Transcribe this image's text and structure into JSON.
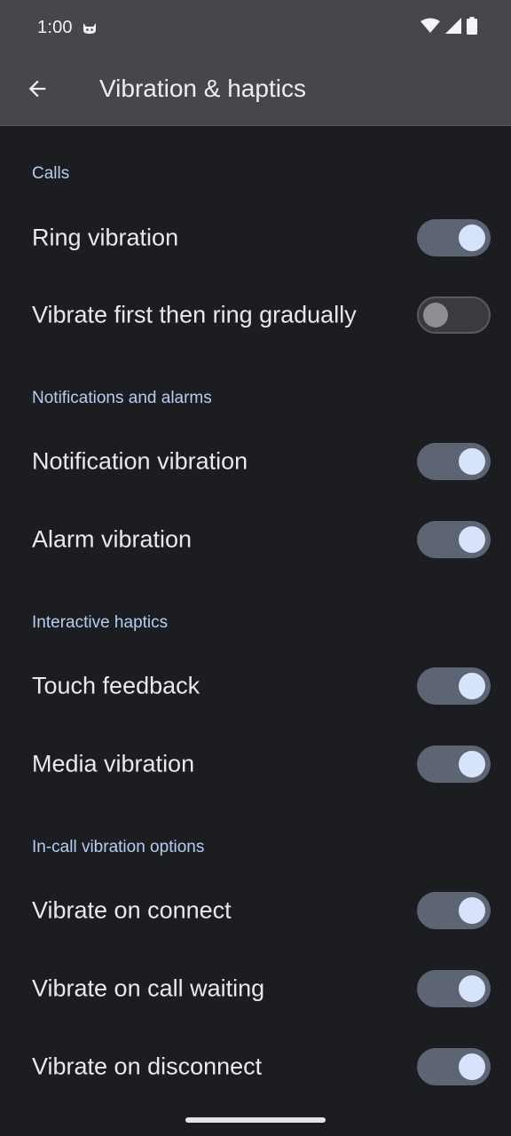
{
  "status_bar": {
    "time": "1:00",
    "icons": [
      "cat-app-icon",
      "wifi-icon",
      "cell-signal-icon",
      "battery-icon"
    ]
  },
  "app_bar": {
    "back_icon": "arrow-back-icon",
    "title": "Vibration & haptics"
  },
  "sections": [
    {
      "header": "Calls",
      "items": [
        {
          "label": "Ring vibration",
          "on": true
        },
        {
          "label": "Vibrate first then ring gradually",
          "on": false
        }
      ]
    },
    {
      "header": "Notifications and alarms",
      "items": [
        {
          "label": "Notification vibration",
          "on": true
        },
        {
          "label": "Alarm vibration",
          "on": true
        }
      ]
    },
    {
      "header": "Interactive haptics",
      "items": [
        {
          "label": "Touch feedback",
          "on": true
        },
        {
          "label": "Media vibration",
          "on": true
        }
      ]
    },
    {
      "header": "In-call vibration options",
      "items": [
        {
          "label": "Vibrate on connect",
          "on": true
        },
        {
          "label": "Vibrate on call waiting",
          "on": true
        },
        {
          "label": "Vibrate on disconnect",
          "on": true
        }
      ]
    }
  ],
  "colors": {
    "accent": "#b6cdf3",
    "switch_on_track": "#5d6473",
    "switch_on_thumb": "#d7e3fb",
    "background": "#1c1d20",
    "app_bar": "#45474b"
  }
}
